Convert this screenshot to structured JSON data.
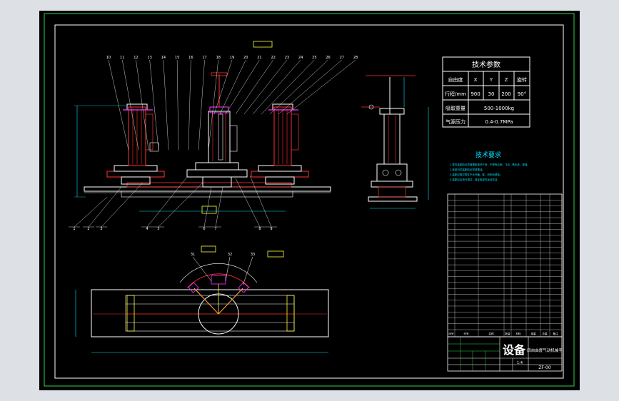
{
  "drawing": {
    "background": "#000000",
    "frame_color": "#2fd24a",
    "border_color": "#ffffff",
    "accent_red": "#ff3333",
    "accent_magenta": "#ff33ff",
    "accent_cyan": "#00e5ff",
    "accent_yellow": "#ffff33"
  },
  "tech_params": {
    "title": "技术参数",
    "rows": [
      {
        "label": "自由度",
        "cells": [
          "X",
          "Y",
          "Z",
          "旋转"
        ]
      },
      {
        "label": "行程/mm",
        "cells": [
          "900",
          "30",
          "200",
          "90°"
        ]
      },
      {
        "label": "吸取重量",
        "cells": [
          "500-1000kg"
        ]
      },
      {
        "label": "气源压力",
        "cells": [
          "0.4-0.7MPa"
        ]
      }
    ]
  },
  "tech_requirements": {
    "title": "技术要求",
    "lines": [
      "1.零件装配前必须清理和清洗干净，不得有毛刺、飞边、氧化皮、锈蚀。",
      "2.各密封件装配前必须浸透油。",
      "3.装配过程中零件不允许磕、碰、划伤和锈蚀。",
      "4.装配后应进行调试，保证各部件运动灵活。"
    ]
  },
  "title_block": {
    "main_label": "设备",
    "product_name": "四自由度气动机械手",
    "drawing_no": "ZF-00",
    "scale": "1:4",
    "header_cells": [
      "序号",
      "代号",
      "名称",
      "数量",
      "材料",
      "单重",
      "总重",
      "备注"
    ]
  },
  "callouts": {
    "top_numbers": [
      "10",
      "11",
      "12",
      "13",
      "14",
      "15",
      "16",
      "17",
      "18",
      "19",
      "20",
      "21",
      "22",
      "23",
      "24",
      "25",
      "26",
      "27",
      "28"
    ],
    "bottom_numbers": [
      "1",
      "2",
      "3",
      "4",
      "5",
      "6",
      "7",
      "8",
      "9"
    ],
    "plan_numbers": [
      "31",
      "32",
      "33"
    ]
  }
}
